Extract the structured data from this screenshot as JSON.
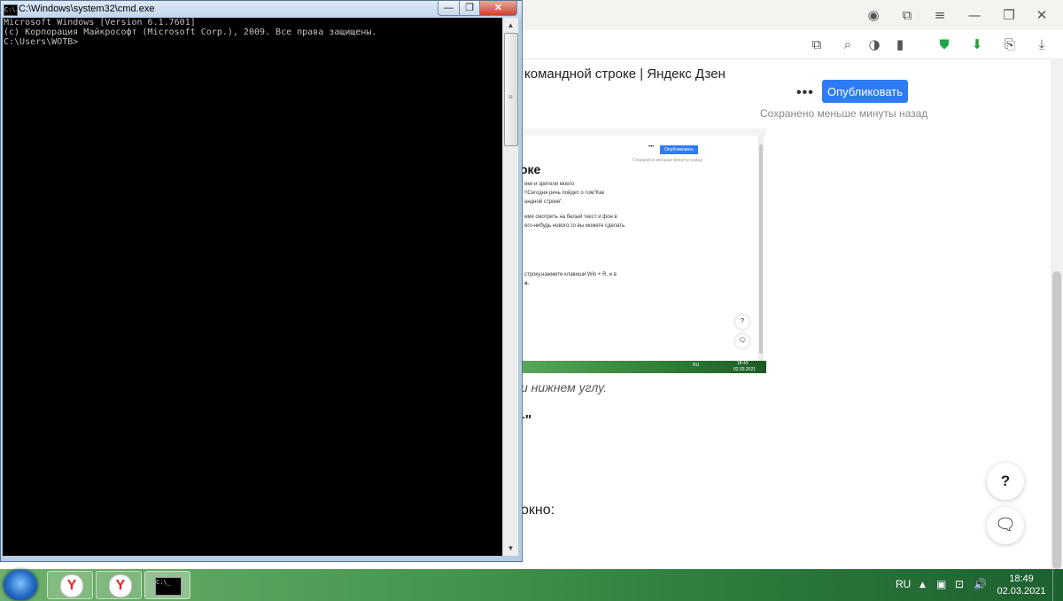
{
  "cmd": {
    "title": "C:\\Windows\\system32\\cmd.exe",
    "console_lines": [
      "Microsoft Windows [Version 6.1.7601]",
      "(c) Корпорация Майкрософт (Microsoft Corp.), 2009. Все права защищены.",
      "",
      "C:\\Users\\WOTB>"
    ],
    "min_glyph": "—",
    "max_glyph": "❐",
    "close_glyph": "✕",
    "title_icon_text": "C:\\"
  },
  "browser": {
    "tab_title": "командной строке | Яндекс Дзен",
    "toolbar": {
      "more_dots": "•••",
      "publish_label": "Опубликовать",
      "saved_status": "Сохранено меньше минуты назад"
    },
    "embedded": {
      "mini_dots": "•••",
      "mini_publish": "Опубликовать",
      "mini_saved": "Сохранено меньше минуты назад",
      "heading": "оке",
      "lines": [
        "ики и зрители моего",
        "!!Сегодня речь пойдет о том\"Как",
        "андной строке\".",
        "емя смотреть на белый текст и фон в",
        "его-нибудь нового,то вы можете сделать",
        "строку,нажмите клавиши Win + R, и в",
        "а."
      ],
      "mini_help": "?",
      "mini_lang": "RU",
      "mini_time": "18:43",
      "mini_date": "02.03.2021"
    },
    "fragments": {
      "corner": "и нижнем углу.",
      "quote": "г\"",
      "window": "окно:"
    },
    "help_glyph": "?"
  },
  "taskbar": {
    "yandex_letter": "Y",
    "cmd_icon_text": "C:\\_",
    "lang": "RU",
    "time": "18:49",
    "date": "02.03.2021"
  }
}
